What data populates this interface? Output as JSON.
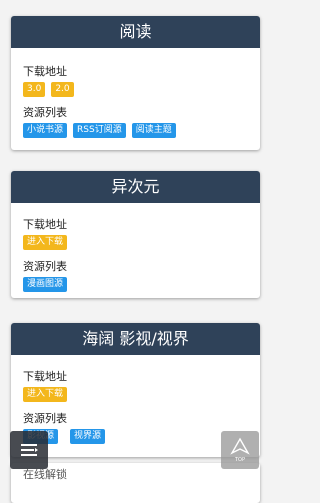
{
  "cards": [
    {
      "title": "阅读",
      "download_label": "下载地址",
      "download_buttons": [
        "3.0",
        "2.0"
      ],
      "resources_label": "资源列表",
      "resource_buttons": [
        "小说书源",
        "RSS订阅源",
        "阅读主题"
      ]
    },
    {
      "title": "异次元",
      "download_label": "下载地址",
      "download_buttons": [
        "进入下载"
      ],
      "resources_label": "资源列表",
      "resource_buttons": [
        "漫画图源"
      ]
    },
    {
      "title": "海阔 影视/视界",
      "download_label": "下载地址",
      "download_buttons": [
        "进入下载"
      ],
      "resources_label": "资源列表",
      "resource_buttons": [
        "影视源",
        "视界源"
      ]
    },
    {
      "title": "",
      "partial_label": "在线解锁"
    }
  ],
  "floating": {
    "top_label": "TOP"
  },
  "colors": {
    "header": "#2f4259",
    "download_button": "#f3b71c",
    "resource_button": "#2496e9"
  }
}
